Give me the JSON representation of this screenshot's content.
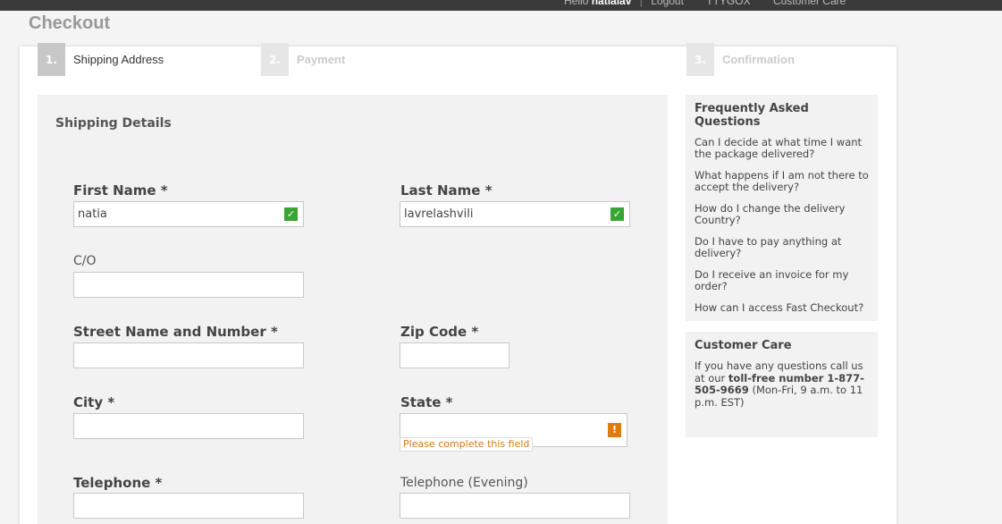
{
  "topbar": {
    "hello": "Hello",
    "username": "natialav",
    "separator": "|",
    "logout": "Logout",
    "link1": "TTYGOX",
    "customer_care": "Customer Care"
  },
  "page": {
    "title": "Checkout"
  },
  "steps": [
    {
      "num": "1.",
      "label": "Shipping Address",
      "active": true
    },
    {
      "num": "2.",
      "label": "Payment",
      "active": false
    },
    {
      "num": "3.",
      "label": "Confirmation",
      "active": false
    }
  ],
  "form": {
    "section_title": "Shipping Details",
    "first_name": {
      "label": "First Name *",
      "value": "natia"
    },
    "last_name": {
      "label": "Last Name *",
      "value": "lavrelashvili"
    },
    "co": {
      "label": "C/O",
      "value": ""
    },
    "street": {
      "label": "Street Name and Number *",
      "value": ""
    },
    "zip": {
      "label": "Zip Code *",
      "value": ""
    },
    "city": {
      "label": "City *",
      "value": ""
    },
    "state": {
      "label": "State *",
      "value": "",
      "error": "Please complete this field",
      "warn_glyph": "!"
    },
    "telephone": {
      "label": "Telephone *",
      "value": ""
    },
    "telephone_evening": {
      "label": "Telephone (Evening)",
      "value": ""
    },
    "check_glyph": "✓"
  },
  "faq": {
    "title": "Frequently Asked Questions",
    "items": [
      "Can I decide at what time I want the package delivered?",
      "What happens if I am not there to accept the delivery?",
      "How do I change the delivery Country?",
      "Do I have to pay anything at delivery?",
      "Do I receive an invoice for my order?",
      "How can I access Fast Checkout?"
    ]
  },
  "care": {
    "title": "Customer Care",
    "text_before": "If you have any questions call us at our",
    "bold": "toll-free number 1-877-505-9669",
    "text_after": "(Mon-Fri, 9 a.m. to 11 p.m. EST)"
  },
  "colors": {
    "ok_green": "#3aa533",
    "warn_orange": "#e07b10"
  }
}
